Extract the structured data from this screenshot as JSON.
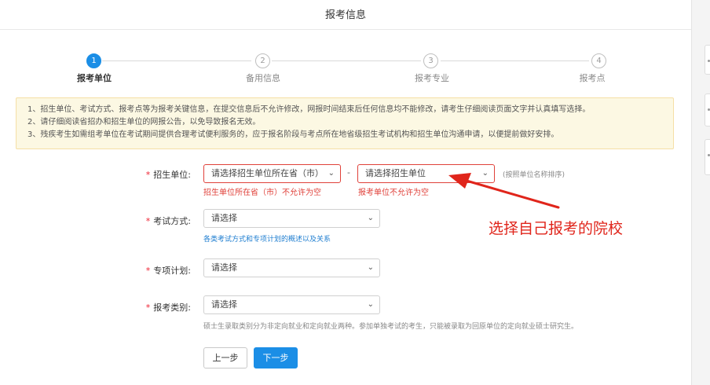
{
  "header": {
    "title": "报考信息"
  },
  "steps": [
    {
      "num": "1",
      "label": "报考单位",
      "active": true
    },
    {
      "num": "2",
      "label": "备用信息",
      "active": false
    },
    {
      "num": "3",
      "label": "报考专业",
      "active": false
    },
    {
      "num": "4",
      "label": "报考点",
      "active": false
    }
  ],
  "notice": {
    "lines": [
      "1、招生单位、考试方式、报考点等为报考关键信息，在提交信息后不允许修改，网报时间结束后任何信息均不能修改，请考生仔细阅读页面文字并认真填写选择。",
      "2、请仔细阅读省招办和招生单位的网报公告，以免导致报名无效。",
      "3、残疾考生如需组考单位在考试期间提供合理考试便利服务的，应于报名阶段与考点所在地省级招生考试机构和招生单位沟通申请，以便提前做好安排。"
    ]
  },
  "form": {
    "unit": {
      "label": "招生单位:",
      "province_value": "请选择招生单位所在省（市）",
      "unit_value": "请选择招生单位",
      "separator": "-",
      "sort_hint": "(按照单位名称排序)",
      "province_error": "招生单位所在省（市）不允许为空",
      "unit_error": "报考单位不允许为空"
    },
    "exam_mode": {
      "label": "考试方式:",
      "value": "请选择",
      "link": "各类考试方式和专项计划的概述以及关系"
    },
    "special_plan": {
      "label": "专项计划:",
      "value": "请选择"
    },
    "apply_type": {
      "label": "报考类别:",
      "value": "请选择",
      "hint": "硕士生录取类别分为非定向就业和定向就业两种。参加单独考试的考生，只能被录取为回原单位的定向就业硕士研究生。"
    }
  },
  "buttons": {
    "prev": "上一步",
    "next": "下一步"
  },
  "annotation": {
    "text": "选择自己报考的院校",
    "color": "#e0251b"
  },
  "colors": {
    "primary": "#1b8ee6",
    "error": "#e0413a",
    "notice_bg": "#fcf8e3"
  }
}
